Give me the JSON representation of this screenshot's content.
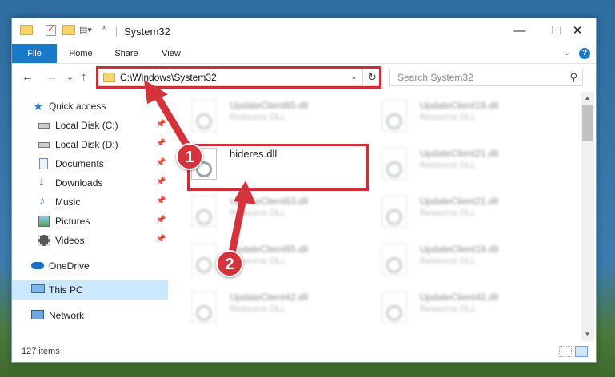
{
  "window": {
    "title": "System32",
    "controls": {
      "minimize": "—",
      "maximize": "☐",
      "close": "✕"
    }
  },
  "ribbon": {
    "tabs": [
      "File",
      "Home",
      "Share",
      "View"
    ],
    "collapse": "⌄",
    "help": "?"
  },
  "nav": {
    "back": "←",
    "forward": "→",
    "recent": "⌄",
    "up": "↑",
    "address": "C:\\Windows\\System32",
    "refresh": "↻",
    "search_placeholder": "Search System32"
  },
  "sidebar": {
    "items": [
      {
        "label": "Quick access",
        "icon": "star-icon",
        "pinned": false
      },
      {
        "label": "Local Disk (C:)",
        "icon": "drive-icon",
        "pinned": true
      },
      {
        "label": "Local Disk (D:)",
        "icon": "drive-icon",
        "pinned": true
      },
      {
        "label": "Documents",
        "icon": "documents-icon",
        "pinned": true
      },
      {
        "label": "Downloads",
        "icon": "download-icon",
        "pinned": true
      },
      {
        "label": "Music",
        "icon": "music-icon",
        "pinned": true
      },
      {
        "label": "Pictures",
        "icon": "pictures-icon",
        "pinned": true
      },
      {
        "label": "Videos",
        "icon": "videos-icon",
        "pinned": true
      },
      {
        "label": "OneDrive",
        "icon": "cloud-icon",
        "pinned": false
      },
      {
        "label": "This PC",
        "icon": "computer-icon",
        "pinned": false,
        "selected": true
      },
      {
        "label": "Network",
        "icon": "network-icon",
        "pinned": false
      }
    ],
    "pin_glyph": "📌"
  },
  "files": {
    "left": [
      {
        "name": "UpdateClient65.dll",
        "type": "Resource DLL",
        "blurred": true
      },
      {
        "name": "hideres.dll",
        "type": "",
        "blurred": false
      },
      {
        "name": "UpdateClient63.dll",
        "type": "Resource DLL",
        "blurred": true
      },
      {
        "name": "UpdateClient65.dll",
        "type": "Resource DLL",
        "blurred": true
      },
      {
        "name": "UpdateClient42.dll",
        "type": "Resource DLL",
        "blurred": true
      }
    ],
    "right": [
      {
        "name": "UpdateClient19.dll",
        "type": "Resource DLL",
        "blurred": true
      },
      {
        "name": "UpdateClient21.dll",
        "type": "Resource DLL",
        "blurred": true
      },
      {
        "name": "UpdateClient21.dll",
        "type": "Resource DLL",
        "blurred": true
      },
      {
        "name": "UpdateClient19.dll",
        "type": "Resource DLL",
        "blurred": true
      },
      {
        "name": "UpdateClient42.dll",
        "type": "Resource DLL",
        "blurred": true
      }
    ]
  },
  "status": {
    "item_count": "127 items"
  },
  "annotations": {
    "step1": "1",
    "step2": "2",
    "highlight_color": "#c8303a"
  },
  "colors": {
    "accent": "#1979ca",
    "selection": "#cce8ff",
    "annotation": "#d4333c"
  }
}
